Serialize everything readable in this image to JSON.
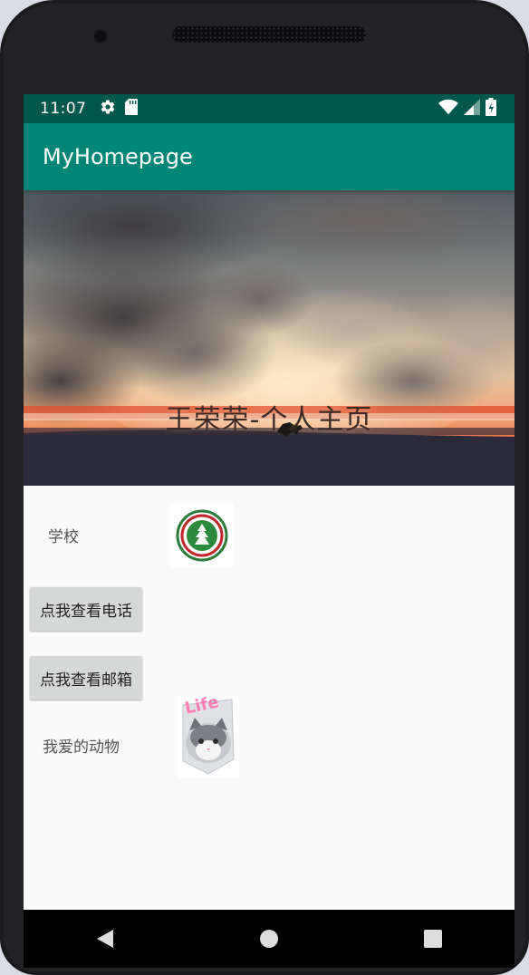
{
  "status_bar": {
    "time": "11:07",
    "left_icons": [
      "gear-icon",
      "sd-card-icon"
    ],
    "right_icons": [
      "wifi-icon",
      "cell-signal-icon",
      "battery-icon"
    ]
  },
  "app_bar": {
    "title": "MyHomepage"
  },
  "header": {
    "title": "王荣荣-个人主页"
  },
  "content": {
    "school_label": "学校",
    "phone_button": "点我查看电话",
    "email_button": "点我查看邮箱",
    "pet_label": "我爱的动物",
    "cat_sticker_text": "Life"
  },
  "nav_bar": {
    "buttons": [
      "back-icon",
      "home-icon",
      "recents-icon"
    ]
  },
  "colors": {
    "status_bar": "#00574b",
    "app_bar": "#008577",
    "button": "#d6d7d7",
    "background": "#fafafa"
  }
}
